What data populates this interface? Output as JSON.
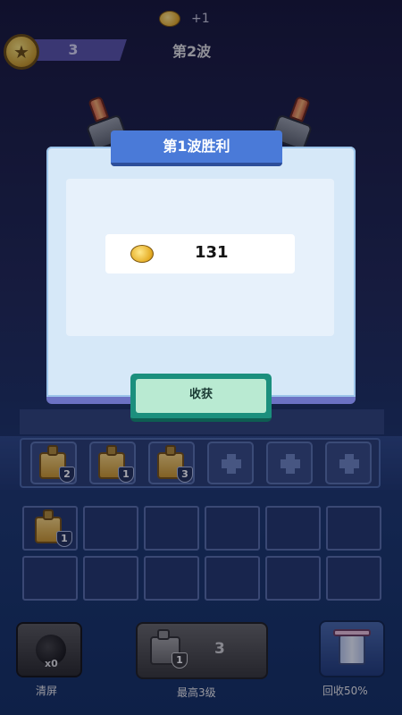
{
  "top_bar": {
    "coins": "3",
    "coin_gain": "+1",
    "wave": "第2波"
  },
  "modal": {
    "title": "第1波胜利",
    "reward_amount": "131",
    "harvest_label": "收获"
  },
  "tray": [
    {
      "level": "2",
      "filled": true
    },
    {
      "level": "1",
      "filled": true
    },
    {
      "level": "3",
      "filled": true
    },
    {
      "level": "",
      "filled": false
    },
    {
      "level": "",
      "filled": false
    },
    {
      "level": "",
      "filled": false
    }
  ],
  "grid": {
    "first_cell_level": "1"
  },
  "controls": {
    "clear_count": "x0",
    "clear_label": "清屏",
    "max_unit_level": "1",
    "max_level_num": "3",
    "max_label": "最高3级",
    "recycle_label": "回收50%"
  }
}
